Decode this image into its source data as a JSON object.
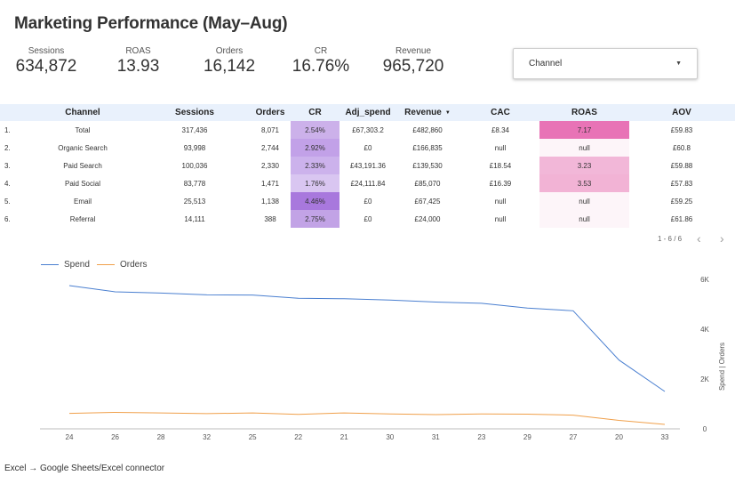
{
  "page": {
    "title": "Marketing Performance (May–Aug)"
  },
  "kpis": [
    {
      "label": "Sessions",
      "value": "634,872"
    },
    {
      "label": "ROAS",
      "value": "13.93"
    },
    {
      "label": "Orders",
      "value": "16,142"
    },
    {
      "label": "CR",
      "value": "16.76%"
    },
    {
      "label": "Revenue",
      "value": "965,720"
    }
  ],
  "filter": {
    "label": "Channel",
    "caret": "▼"
  },
  "table": {
    "headers": [
      "Channel",
      "Sessions",
      "Orders",
      "CR",
      "Adj_spend",
      "Revenue",
      "CAC",
      "ROAS",
      "AOV"
    ],
    "sort_caret": "▼",
    "rows": [
      [
        "1.",
        "Total",
        "317,436",
        "8,071",
        "2.54%",
        "£67,303.2",
        "£482,860",
        "£8.34",
        "7.17",
        "£59.83"
      ],
      [
        "2.",
        "Organic Search",
        "93,998",
        "2,744",
        "2.92%",
        "£0",
        "£166,835",
        "null",
        "null",
        "£60.8"
      ],
      [
        "3.",
        "Paid Search",
        "100,036",
        "2,330",
        "2.33%",
        "£43,191.36",
        "£139,530",
        "£18.54",
        "3.23",
        "£59.88"
      ],
      [
        "4.",
        "Paid Social",
        "83,778",
        "1,471",
        "1.76%",
        "£24,111.84",
        "£85,070",
        "£16.39",
        "3.53",
        "£57.83"
      ],
      [
        "5.",
        "Email",
        "25,513",
        "1,138",
        "4.46%",
        "£0",
        "£67,425",
        "null",
        "null",
        "£59.25"
      ],
      [
        "6.",
        "Referral",
        "14,111",
        "388",
        "2.75%",
        "£0",
        "£24,000",
        "null",
        "null",
        "£61.86"
      ]
    ],
    "cr_heat_colors": [
      "#ccb1ea",
      "#c2a1e8",
      "#ccb2ec",
      "#d9c6f1",
      "#a878dd",
      "#c2a3e6"
    ],
    "roas_heat_colors": [
      "#e873b6",
      "#fdf5f9",
      "#f2b7d8",
      "#f2b3d5",
      "#fdf5f9",
      "#fdf5f9"
    ]
  },
  "pagination": {
    "text": "1 - 6 / 6",
    "prev": "‹",
    "next": "›"
  },
  "chart_data": {
    "type": "line",
    "x": [
      "24",
      "26",
      "28",
      "32",
      "25",
      "22",
      "21",
      "30",
      "31",
      "23",
      "29",
      "27",
      "20",
      "33"
    ],
    "series": [
      {
        "name": "Spend",
        "color": "#4a7fd0",
        "values": [
          5750,
          5500,
          5450,
          5380,
          5370,
          5240,
          5220,
          5170,
          5090,
          5040,
          4850,
          4740,
          2760,
          1500
        ]
      },
      {
        "name": "Orders",
        "color": "#f0a04b",
        "values": [
          620,
          660,
          640,
          610,
          640,
          580,
          640,
          600,
          570,
          600,
          590,
          550,
          340,
          180
        ]
      }
    ],
    "y_ticks": [
      "0",
      "2K",
      "4K",
      "6K"
    ],
    "ylim": [
      0,
      6000
    ],
    "ylabel": "Spend | Orders",
    "legend": "top-left",
    "grid": false
  },
  "footer": {
    "text": "Excel → Google Sheets/Excel connector"
  }
}
